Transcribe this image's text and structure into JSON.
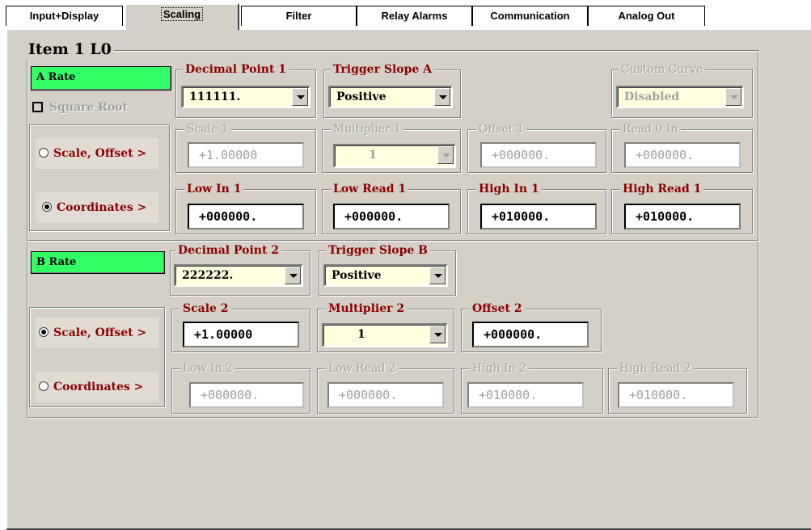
{
  "tabs": [
    "Input+Display",
    "Scaling",
    "Filter",
    "Relay Alarms",
    "Communication",
    "Analog Out"
  ],
  "item_title": "Item 1  L0",
  "a": {
    "rate_label": "A Rate",
    "square_root": "Square Root",
    "scale_offset_label": "Scale, Offset  >",
    "coordinates_label": "Coordinates  >",
    "decimal_point_title": "Decimal Point 1",
    "decimal_point_value": "111111.",
    "trigger_slope_title": "Trigger Slope A",
    "trigger_slope_value": "Positive",
    "custom_curve_title": "Custom Curve",
    "custom_curve_value": "Disabled",
    "scale_title": "Scale 1",
    "scale_value": "+1.00000",
    "multiplier_title": "Multiplier 1",
    "multiplier_value": "1",
    "offset_title": "Offset 1",
    "offset_value": "+000000.",
    "read0_title": "Read 0 In",
    "read0_value": "+000000.",
    "low_in_title": "Low In 1",
    "low_in_value": "+000000.",
    "low_read_title": "Low Read 1",
    "low_read_value": "+000000.",
    "high_in_title": "High In 1",
    "high_in_value": "+010000.",
    "high_read_title": "High Read 1",
    "high_read_value": "+010000."
  },
  "b": {
    "rate_label": "B Rate",
    "scale_offset_label": "Scale, Offset  >",
    "coordinates_label": "Coordinates  >",
    "decimal_point_title": "Decimal Point 2",
    "decimal_point_value": "222222.",
    "trigger_slope_title": "Trigger Slope B",
    "trigger_slope_value": "Positive",
    "scale_title": "Scale 2",
    "scale_value": "+1.00000",
    "multiplier_title": "Multiplier 2",
    "multiplier_value": "1",
    "offset_title": "Offset 2",
    "offset_value": "+000000.",
    "low_in_title": "Low In 2",
    "low_in_value": "+000000.",
    "low_read_title": "Low Read 2",
    "low_read_value": "+000000.",
    "high_in_title": "High In 2",
    "high_in_value": "+010000.",
    "high_read_title": "High Read 2",
    "high_read_value": "+010000."
  }
}
